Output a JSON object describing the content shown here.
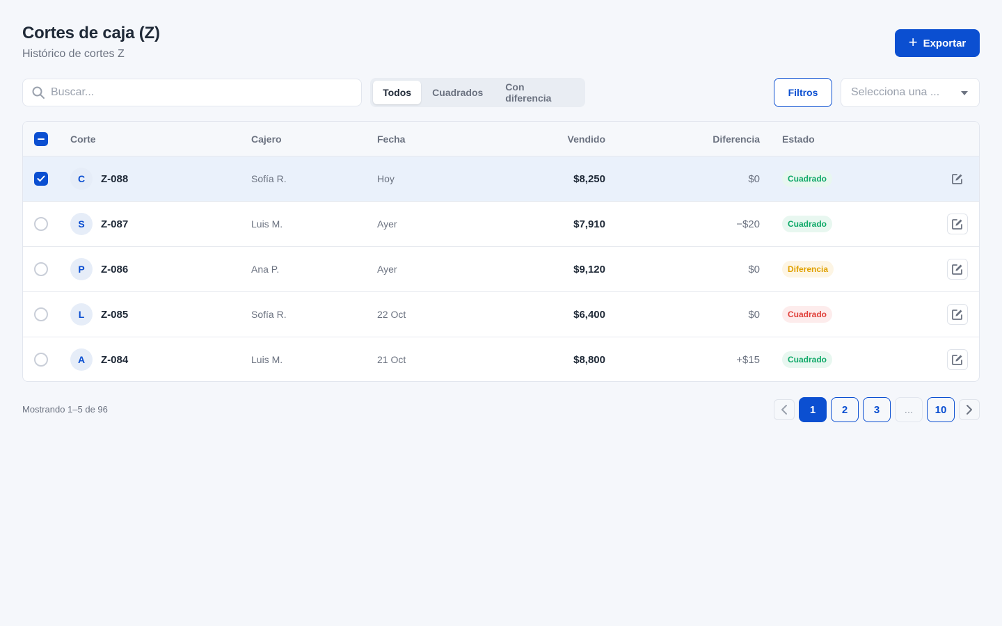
{
  "header": {
    "title": "Cortes de caja (Z)",
    "subtitle": "Histórico de cortes Z",
    "export_label": "Exportar"
  },
  "toolbar": {
    "search_placeholder": "Buscar...",
    "segments": [
      {
        "label": "Todos",
        "active": true
      },
      {
        "label": "Cuadrados",
        "active": false
      },
      {
        "label": "Con diferencia",
        "active": false
      }
    ],
    "filters_label": "Filtros",
    "select_placeholder": "Selecciona una ..."
  },
  "table": {
    "columns": {
      "corte": "Corte",
      "cajero": "Cajero",
      "fecha": "Fecha",
      "vendido": "Vendido",
      "diferencia": "Diferencia",
      "estado": "Estado"
    },
    "rows": [
      {
        "initial": "C",
        "corte": "Z-088",
        "cajero": "Sofía R.",
        "fecha": "Hoy",
        "vendido": "$8,250",
        "diferencia": "$0",
        "estado": "Cuadrado",
        "estado_color": "green",
        "selected": true
      },
      {
        "initial": "S",
        "corte": "Z-087",
        "cajero": "Luis M.",
        "fecha": "Ayer",
        "vendido": "$7,910",
        "diferencia": "−$20",
        "estado": "Cuadrado",
        "estado_color": "green",
        "selected": false
      },
      {
        "initial": "P",
        "corte": "Z-086",
        "cajero": "Ana P.",
        "fecha": "Ayer",
        "vendido": "$9,120",
        "diferencia": "$0",
        "estado": "Diferencia",
        "estado_color": "amber",
        "selected": false
      },
      {
        "initial": "L",
        "corte": "Z-085",
        "cajero": "Sofía R.",
        "fecha": "22 Oct",
        "vendido": "$6,400",
        "diferencia": "$0",
        "estado": "Cuadrado",
        "estado_color": "red",
        "selected": false
      },
      {
        "initial": "A",
        "corte": "Z-084",
        "cajero": "Luis M.",
        "fecha": "21 Oct",
        "vendido": "$8,800",
        "diferencia": "+$15",
        "estado": "Cuadrado",
        "estado_color": "green",
        "selected": false
      }
    ]
  },
  "footer": {
    "showing": "Mostrando 1–5 de 96",
    "pages": [
      {
        "label": "1",
        "active": true
      },
      {
        "label": "2",
        "active": false
      },
      {
        "label": "3",
        "active": false
      },
      {
        "label": "...",
        "active": false,
        "ellipsis": true
      },
      {
        "label": "10",
        "active": false
      }
    ]
  },
  "colors": {
    "accent": "#0b4fd1",
    "success": "#0fa968",
    "warning": "#e0a100",
    "danger": "#e0403a"
  }
}
